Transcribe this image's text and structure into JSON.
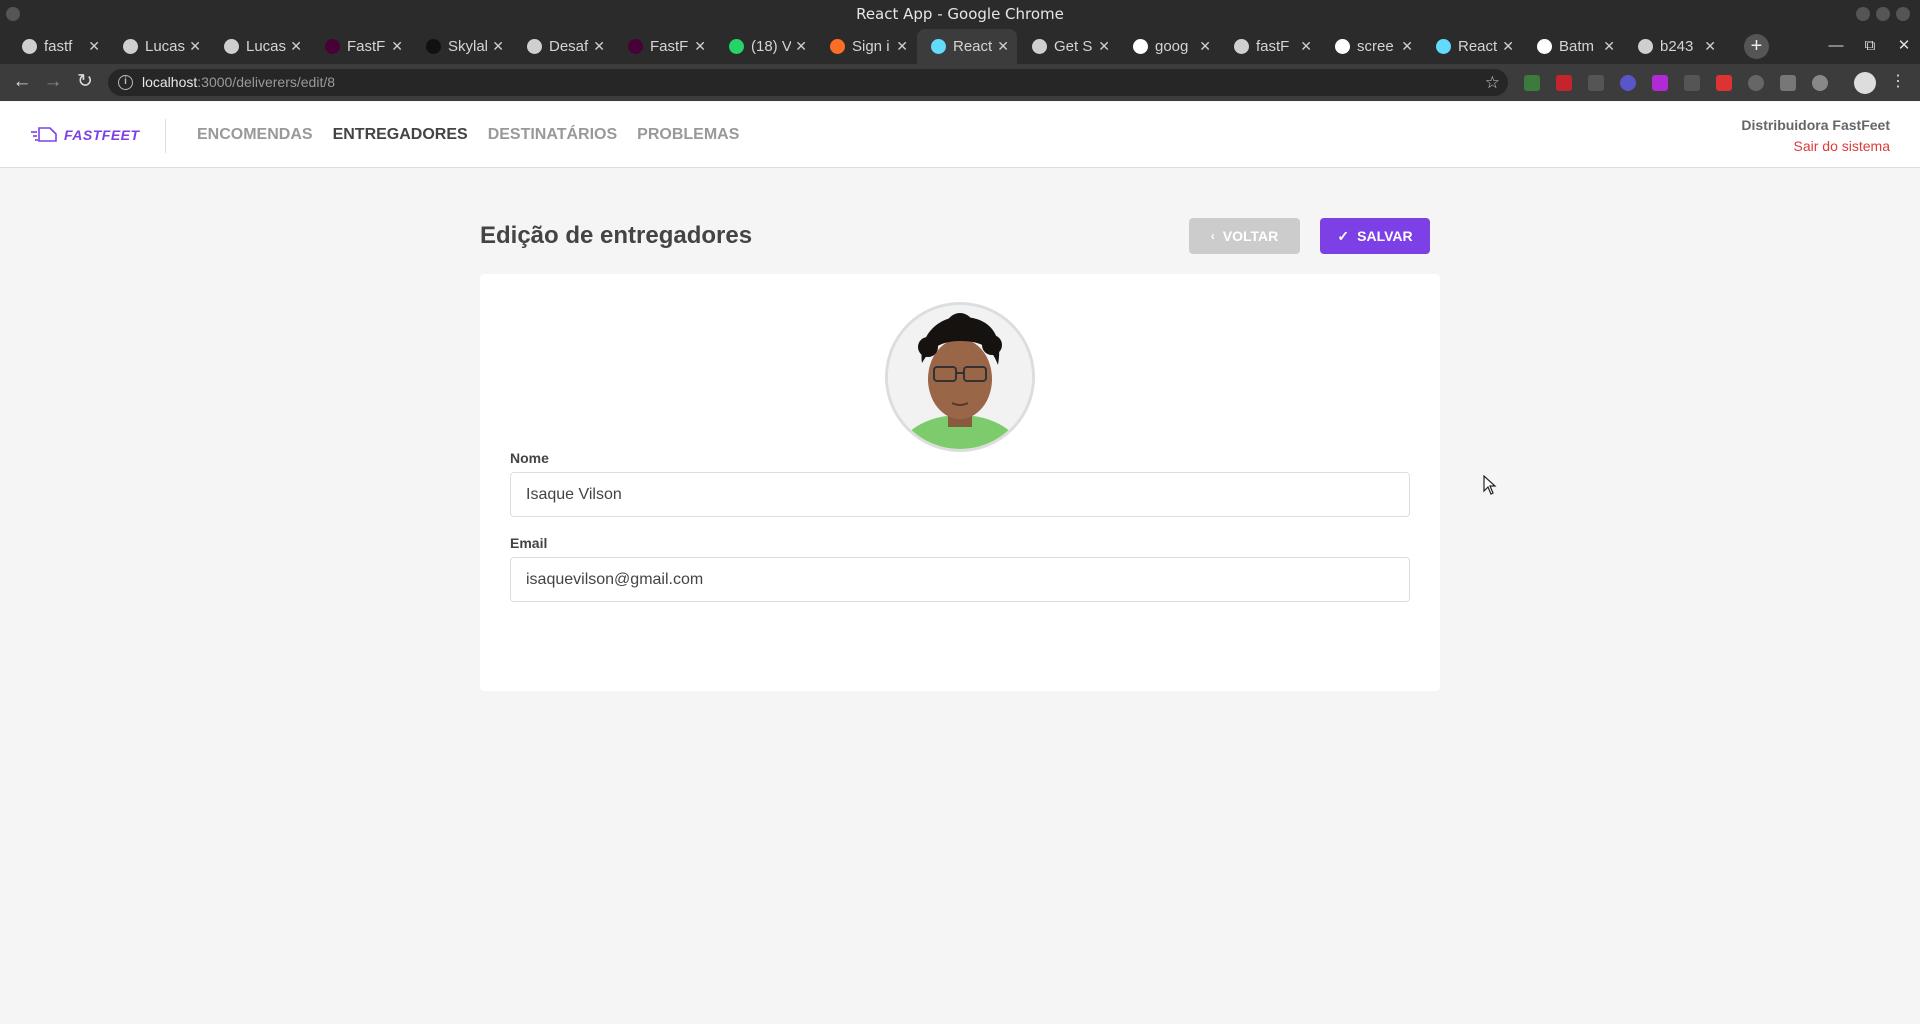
{
  "window": {
    "title": "React App - Google Chrome"
  },
  "tabs": [
    {
      "label": "fastf",
      "fav": "github-icon",
      "color": "#cfcfcf"
    },
    {
      "label": "Lucas",
      "fav": "github-icon",
      "color": "#cfcfcf"
    },
    {
      "label": "Lucas",
      "fav": "github-icon",
      "color": "#cfcfcf"
    },
    {
      "label": "FastF",
      "fav": "adobe-xd-icon",
      "color": "#470137"
    },
    {
      "label": "Skylal",
      "fav": "skylab-icon",
      "color": "#111111"
    },
    {
      "label": "Desaf",
      "fav": "rocketseat-icon",
      "color": "#cfcfcf"
    },
    {
      "label": "FastF",
      "fav": "adobe-xd-icon",
      "color": "#470137"
    },
    {
      "label": "(18) V",
      "fav": "whatsapp-icon",
      "color": "#25d366"
    },
    {
      "label": "Sign i",
      "fav": "gitlab-icon",
      "color": "#fc6d26"
    },
    {
      "label": "React",
      "fav": "react-icon",
      "color": "#61dafb"
    },
    {
      "label": "Get S",
      "fav": "triangle-icon",
      "color": "#cfcfcf"
    },
    {
      "label": "goog",
      "fav": "google-icon",
      "color": "#ffffff"
    },
    {
      "label": "fastF",
      "fav": "github-icon",
      "color": "#cfcfcf"
    },
    {
      "label": "scree",
      "fav": "google-icon",
      "color": "#ffffff"
    },
    {
      "label": "React",
      "fav": "react-icon",
      "color": "#61dafb"
    },
    {
      "label": "Batm",
      "fav": "google-icon",
      "color": "#ffffff"
    },
    {
      "label": "b243",
      "fav": "globe-icon",
      "color": "#cfcfcf"
    }
  ],
  "active_tab_index": 9,
  "omnibox": {
    "host": "localhost",
    "path": ":3000/deliverers/edit/8"
  },
  "app": {
    "logo": "FASTFEET",
    "nav": [
      "ENCOMENDAS",
      "ENTREGADORES",
      "DESTINATÁRIOS",
      "PROBLEMAS"
    ],
    "active_nav": "ENTREGADORES",
    "profile_name": "Distribuidora FastFeet",
    "logout": "Sair do sistema"
  },
  "page": {
    "title": "Edição de entregadores",
    "back_label": "VOLTAR",
    "save_label": "SALVAR",
    "name_label": "Nome",
    "name_value": "Isaque Vilson",
    "email_label": "Email",
    "email_value": "isaquevilson@gmail.com"
  },
  "colors": {
    "accent": "#7d40e7",
    "logout": "#de3b3b",
    "back_button": "#cccccc"
  }
}
